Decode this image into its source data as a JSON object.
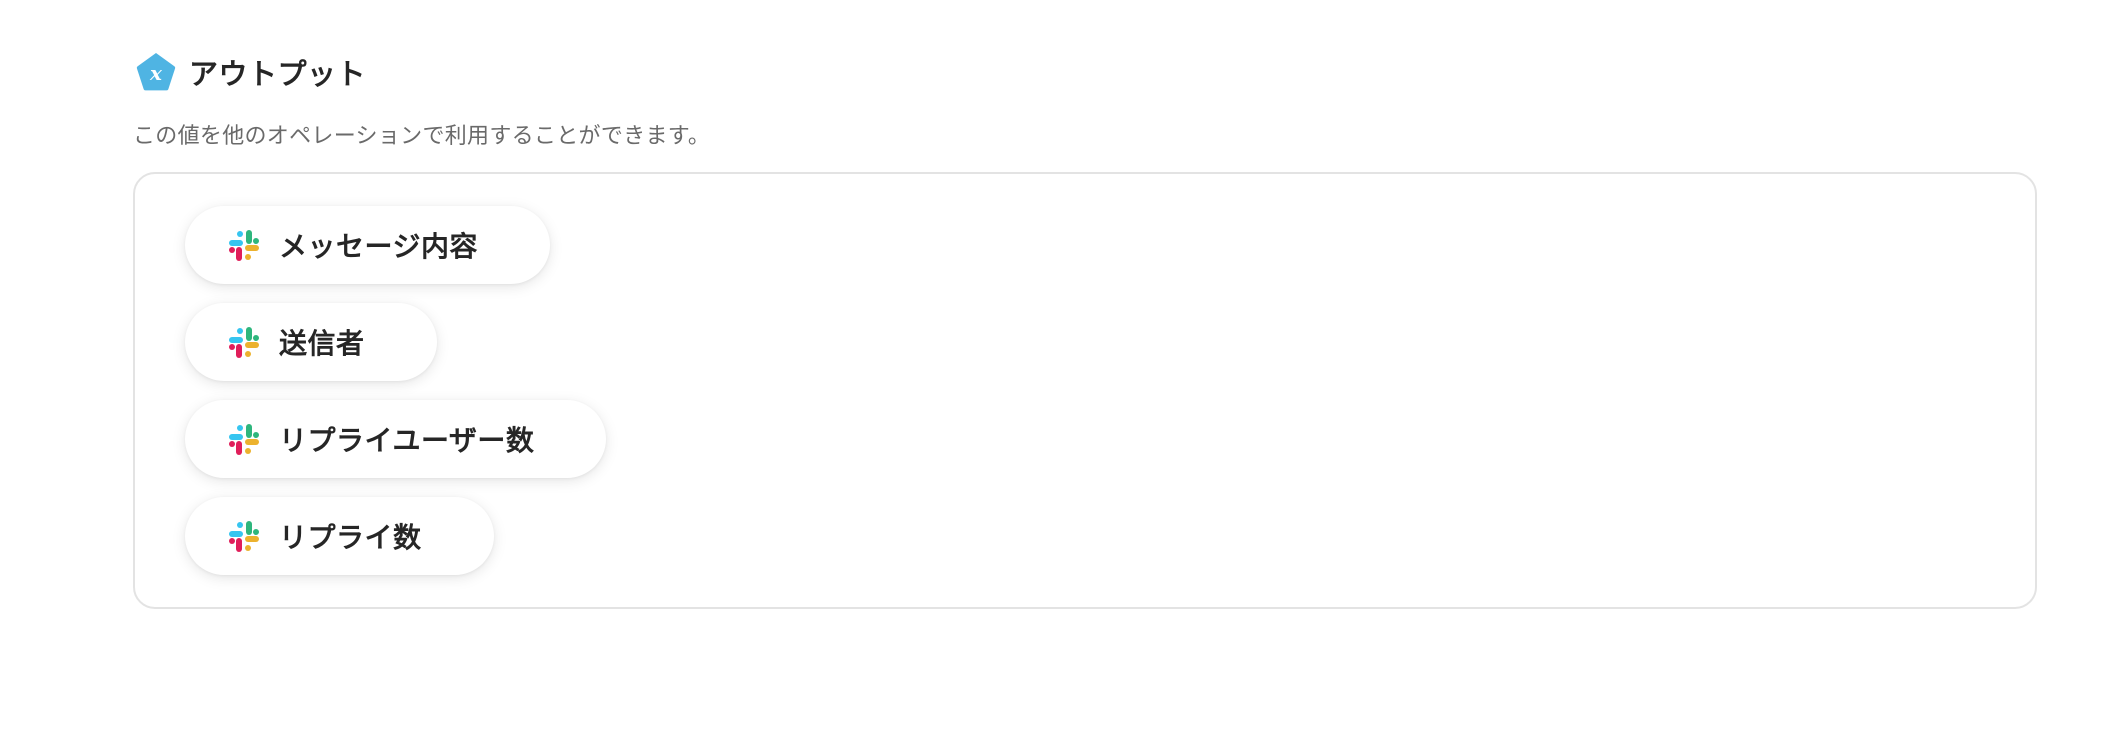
{
  "output": {
    "title": "アウトプット",
    "description": "この値を他のオペレーションで利用することができます。",
    "icon": "variable-pentagon-icon",
    "icon_color": "#4fb4e3",
    "items": [
      {
        "label": "メッセージ内容",
        "icon": "slack-icon"
      },
      {
        "label": "送信者",
        "icon": "slack-icon"
      },
      {
        "label": "リプライユーザー数",
        "icon": "slack-icon"
      },
      {
        "label": "リプライ数",
        "icon": "slack-icon"
      }
    ]
  },
  "colors": {
    "slack_blue": "#36C5F0",
    "slack_green": "#2EB67D",
    "slack_yellow": "#ECB22E",
    "slack_red": "#E01E5A"
  }
}
